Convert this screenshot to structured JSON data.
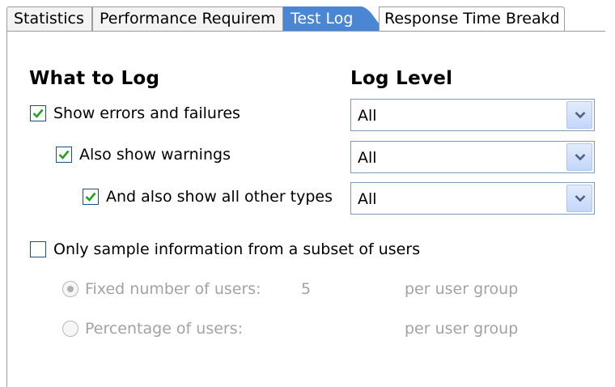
{
  "tabs": [
    {
      "label": "Statistics",
      "active": false
    },
    {
      "label": "Performance Requirem",
      "active": false
    },
    {
      "label": "Test Log",
      "active": true
    },
    {
      "label": "Response Time Breakd",
      "active": false
    }
  ],
  "headings": {
    "what_to_log": "What to Log",
    "log_level": "Log Level"
  },
  "log_rows": [
    {
      "label": "Show errors and failures",
      "checked": true,
      "level": "All"
    },
    {
      "label": "Also show warnings",
      "checked": true,
      "level": "All"
    },
    {
      "label": "And also show all other types",
      "checked": true,
      "level": "All"
    }
  ],
  "sampling": {
    "label": "Only sample information from a subset of users",
    "checked": false,
    "options": [
      {
        "label": "Fixed number of users:",
        "value": "5",
        "suffix": "per user group",
        "selected": true,
        "enabled": false
      },
      {
        "label": "Percentage of users:",
        "value": "",
        "suffix": "per user group",
        "selected": false,
        "enabled": false
      }
    ]
  },
  "colors": {
    "active_tab": "#4a86d4",
    "check_mark": "#21a121",
    "combo_border": "#7f9db9",
    "disabled_text": "#a3a3a3"
  },
  "icons": {
    "checkbox_mark": "check-mark-icon",
    "combo_arrow": "chevron-down-icon",
    "radio_dot": "radio-dot-icon"
  }
}
